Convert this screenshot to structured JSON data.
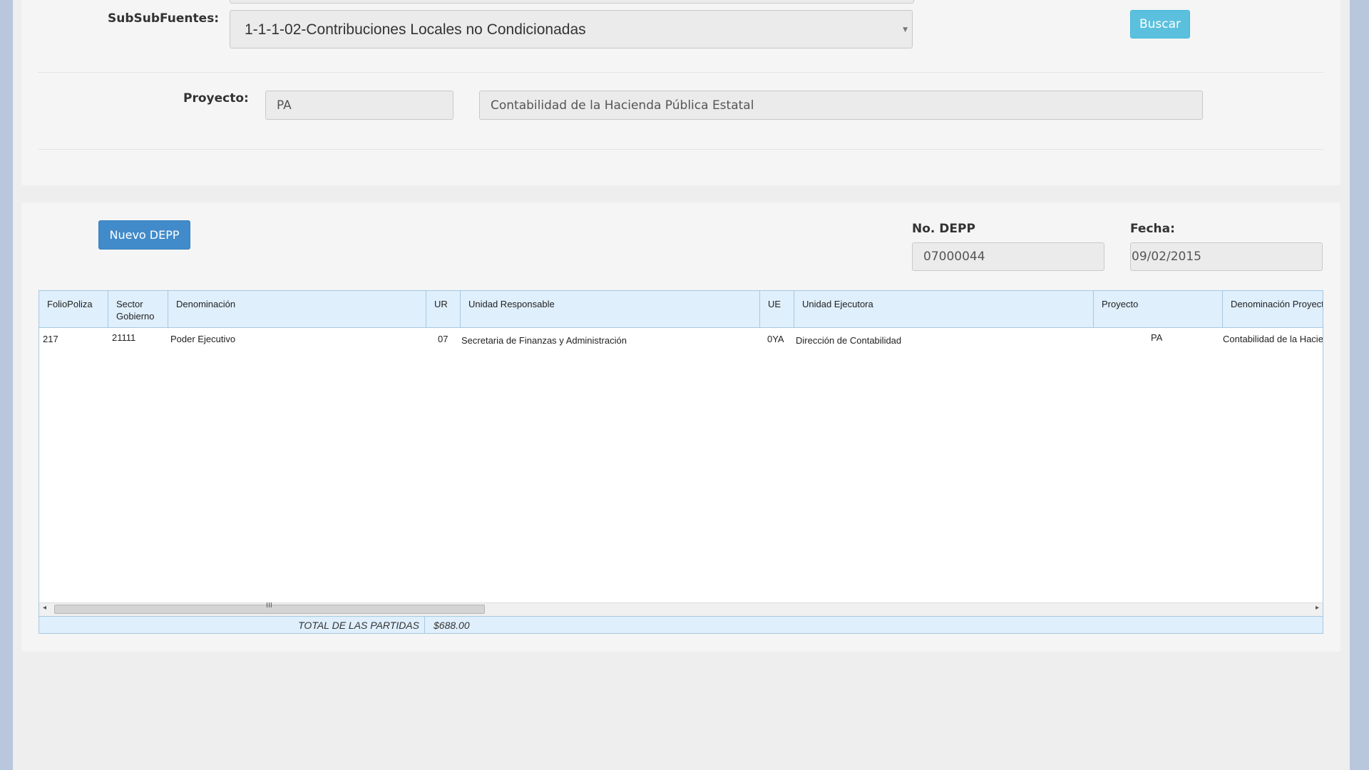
{
  "filters": {
    "subsubfuentes_label": "SubSubFuentes:",
    "subsubfuentes_value": "1-1-1-02-Contribuciones Locales no Condicionadas",
    "buscar_label": "Buscar",
    "proyecto_label": "Proyecto:",
    "proyecto_code": "PA",
    "proyecto_desc": "Contabilidad de la Hacienda Pública Estatal"
  },
  "depp": {
    "nuevo_label": "Nuevo DEPP",
    "no_depp_label": "No. DEPP",
    "no_depp_value": "07000044",
    "fecha_label": "Fecha:",
    "fecha_value": "09/02/2015"
  },
  "grid": {
    "columns": [
      [
        "FolioPoliza"
      ],
      [
        "Sector",
        "Gobierno"
      ],
      [
        "Denominación"
      ],
      [
        "UR"
      ],
      [
        "Unidad Responsable"
      ],
      [
        "UE"
      ],
      [
        "Unidad Ejecutora"
      ],
      [
        "Proyecto"
      ],
      [
        "Denominación Proyecto"
      ]
    ],
    "rows": [
      [
        "217",
        "21111",
        "Poder Ejecutivo",
        "07",
        "Secretaria de Finanzas y Administración",
        "0YA",
        "Dirección de Contabilidad",
        "PA",
        "Contabilidad de la Hacienda Pública Estatal"
      ]
    ],
    "scroll_grip": "III",
    "total_label": "TOTAL DE LAS PARTIDAS",
    "total_value": "$688.00"
  },
  "icons": {
    "select_arrow": "▼",
    "scroll_left": "◂",
    "scroll_right": "▸"
  }
}
